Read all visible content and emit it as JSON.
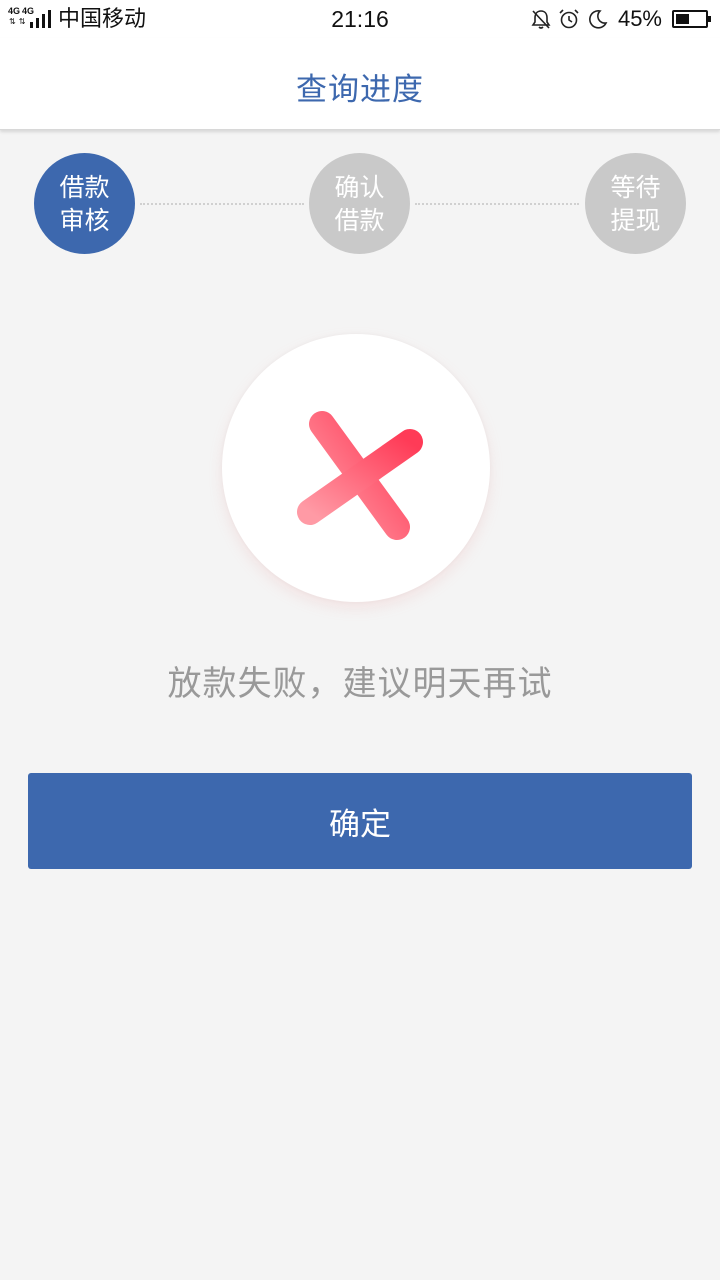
{
  "status_bar": {
    "network_1": "4G",
    "network_2": "4G",
    "carrier": "中国移动",
    "time": "21:16",
    "battery_percent": "45%",
    "battery_level": 0.45,
    "icons": [
      "bell-off-icon",
      "alarm-clock-icon",
      "moon-icon",
      "battery-icon"
    ]
  },
  "header": {
    "title": "查询进度"
  },
  "steps": [
    {
      "line1": "借款",
      "line2": "审核",
      "active": true
    },
    {
      "line1": "确认",
      "line2": "借款",
      "active": false
    },
    {
      "line1": "等待",
      "line2": "提现",
      "active": false
    }
  ],
  "result": {
    "icon": "close-icon",
    "message": "放款失败，建议明天再试"
  },
  "confirm_button": {
    "label": "确定"
  },
  "colors": {
    "primary": "#3d68ae",
    "inactive_step": "#c9c9c9",
    "error_start": "#ff3b57",
    "error_end": "#ff9aa5",
    "background": "#f4f4f4",
    "message_text": "#999999"
  }
}
